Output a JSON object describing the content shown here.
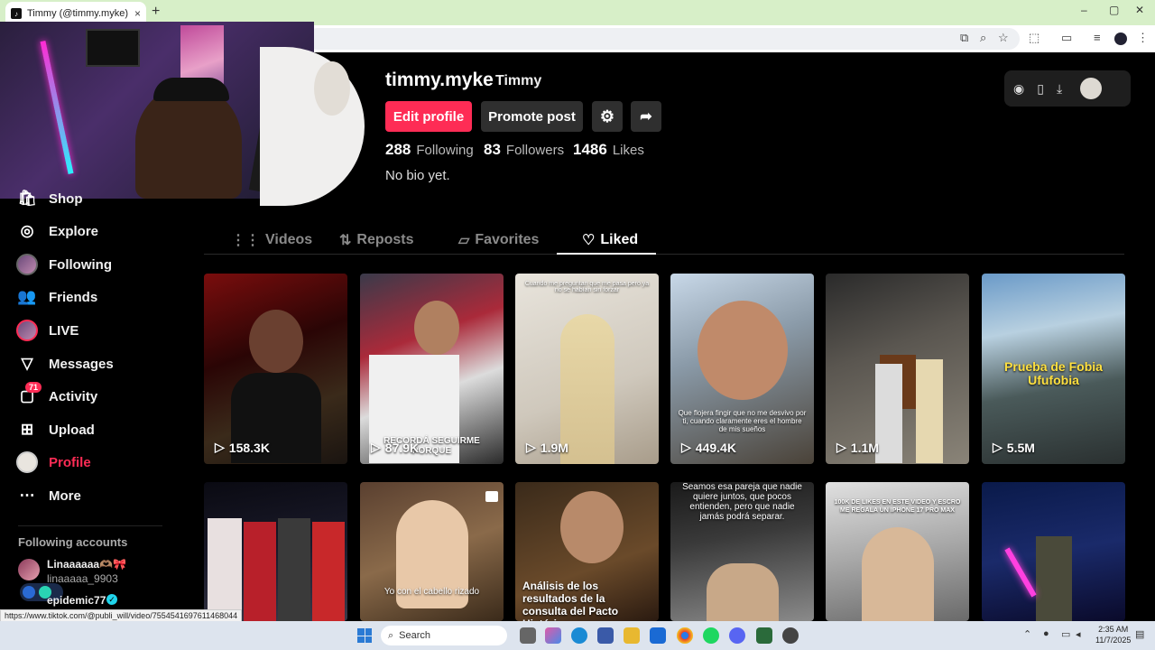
{
  "browser": {
    "tab_title": "Timmy (@timmy.myke) | TikTok",
    "tab_close": "×",
    "new_tab": "+",
    "win_min": "–",
    "win_max": "▢",
    "win_close": "✕"
  },
  "sidebar": {
    "items": [
      {
        "label": "Shop",
        "icon": "shop-icon"
      },
      {
        "label": "Explore",
        "icon": "compass-icon"
      },
      {
        "label": "Following",
        "icon": "following-avatar"
      },
      {
        "label": "Friends",
        "icon": "friends-icon"
      },
      {
        "label": "LIVE",
        "icon": "live-avatar"
      },
      {
        "label": "Messages",
        "icon": "send-icon"
      },
      {
        "label": "Activity",
        "icon": "inbox-icon",
        "badge": "71"
      },
      {
        "label": "Upload",
        "icon": "upload-icon"
      },
      {
        "label": "Profile",
        "icon": "profile-avatar"
      },
      {
        "label": "More",
        "icon": "more-icon"
      }
    ],
    "following_header": "Following accounts",
    "accounts": [
      {
        "display": "Linaaaaaa🫶🏽🎀",
        "handle": "linaaaaa_9903"
      },
      {
        "display": "epidemic77",
        "handle": ""
      }
    ]
  },
  "profile": {
    "username": "timmy.myke",
    "display_name": "Timmy",
    "edit_label": "Edit profile",
    "promote_label": "Promote post",
    "following_count": "288",
    "following_label": "Following",
    "followers_count": "83",
    "followers_label": "Followers",
    "likes_count": "1486",
    "likes_label": "Likes",
    "bio": "No bio yet."
  },
  "tabs": [
    {
      "label": "Videos",
      "icon": "grid-icon"
    },
    {
      "label": "Reposts",
      "icon": "repost-icon"
    },
    {
      "label": "Favorites",
      "icon": "bookmark-icon"
    },
    {
      "label": "Liked",
      "icon": "heart-icon",
      "active": true
    }
  ],
  "videos_row1": [
    {
      "views": "158.3K",
      "caption": ""
    },
    {
      "views": "87.9K",
      "caption": "RECORDÁ SEGUIRME PORQUE"
    },
    {
      "views": "1.9M",
      "caption": "Cuando me preguntan que me pasa pero ya no se habían sin forzar"
    },
    {
      "views": "449.4K",
      "caption": "Que flojera fingir que no me desvivo por ti, cuando claramente eres el hombre de mis sueños"
    },
    {
      "views": "1.1M",
      "caption": ""
    },
    {
      "views": "5.5M",
      "caption": "Prueba de Fobia Ufufobia"
    }
  ],
  "videos_row2": [
    {
      "caption": ""
    },
    {
      "caption": "Yo con el cabello rizado"
    },
    {
      "caption": "Análisis de los resultados de la consulta del Pacto Histórico"
    },
    {
      "caption": "Seamos esa pareja que nadie quiere juntos, que pocos entienden, pero que nadie jamás podrá separar."
    },
    {
      "caption": "100K DE LIKES EN ESTE VIDEO Y ESCRO ME REGALA UN IPHONE 17 PRO MAX"
    },
    {
      "caption": ""
    }
  ],
  "status_url": "https://www.tiktok.com/@publi_will/video/7554541697611468044",
  "taskbar": {
    "search_label": "Search",
    "time": "2:35 AM",
    "date": "11/7/2025"
  },
  "colors": {
    "accent": "#fe2c55",
    "background": "#000000",
    "tab_inactive": "#8a8a8a"
  }
}
